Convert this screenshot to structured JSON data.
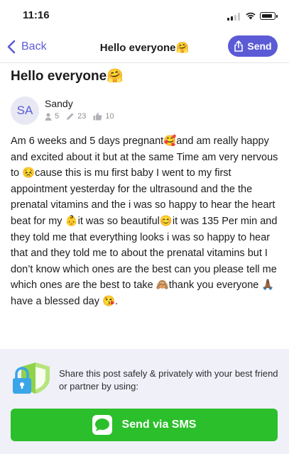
{
  "status_bar": {
    "time": "11:16"
  },
  "nav": {
    "back_label": "Back",
    "title": "Hello everyone🤗",
    "send_label": "Send"
  },
  "post": {
    "title": "Hello everyone🤗",
    "author": {
      "initials": "SA",
      "name": "Sandy",
      "followers": "5",
      "posts": "23",
      "likes": "10"
    },
    "body": "Am 6 weeks and 5 days pregnant🥰and am really happy and excited about it but at the same Time am very nervous to 😣cause this is mu first baby I went to my first appointment yesterday for the ultrasound and the the prenatal vitamins and the i was so happy to hear the heart beat for my 👶it was so beautiful😊it was 135 Per min and they told me that everything looks i was so happy to hear that and they told me to about the prenatal vitamins but I don’t know which ones are the best can you please tell me which ones are the best to take 🙈thank you everyone 🙏🏾 have a blessed day 😘."
  },
  "share": {
    "text": "Share this post safely & privately with your best friend or partner by using:",
    "sms_label": "Send via SMS"
  },
  "colors": {
    "accent": "#5b5bd6",
    "sms_green": "#2bbf2b",
    "share_bg": "#f0f0f8"
  }
}
